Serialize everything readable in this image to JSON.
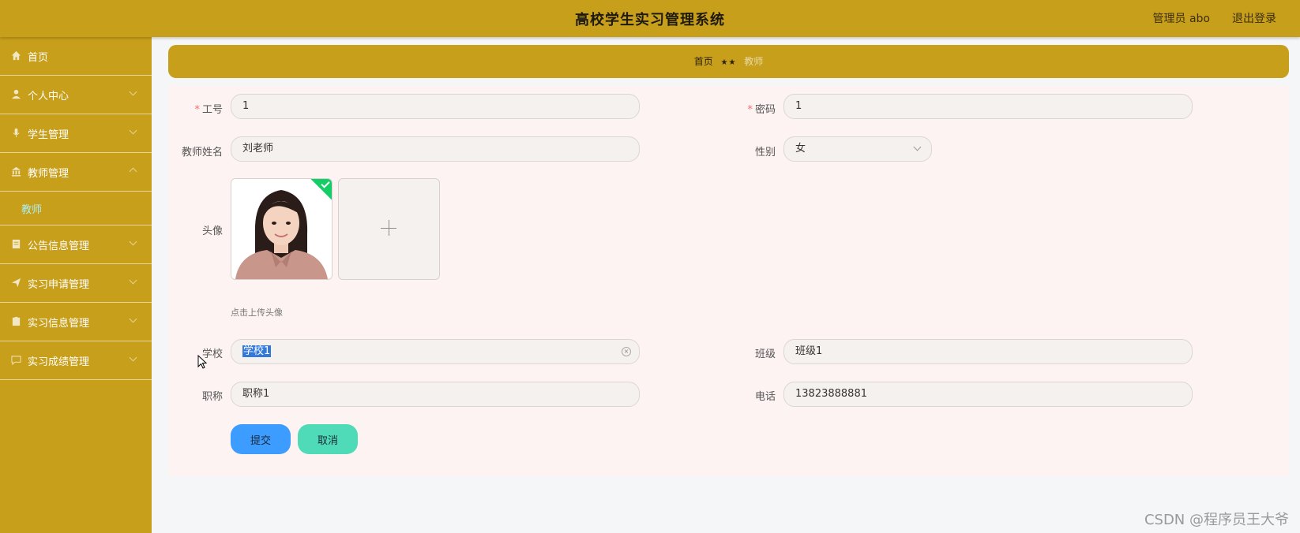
{
  "header": {
    "title": "高校学生实习管理系统",
    "user": "管理员 abo",
    "logout": "退出登录"
  },
  "sidebar": {
    "items": [
      {
        "label": "首页",
        "icon": "home-icon"
      },
      {
        "label": "个人中心",
        "icon": "user-icon"
      },
      {
        "label": "学生管理",
        "icon": "mic-icon"
      },
      {
        "label": "教师管理",
        "icon": "bank-icon"
      },
      {
        "label": "公告信息管理",
        "icon": "doc-icon"
      },
      {
        "label": "实习申请管理",
        "icon": "send-icon"
      },
      {
        "label": "实习信息管理",
        "icon": "clipboard-icon"
      },
      {
        "label": "实习成绩管理",
        "icon": "chat-icon"
      }
    ],
    "subitem": "教师"
  },
  "breadcrumb": {
    "home": "首页",
    "separator": "★★",
    "current": "教师"
  },
  "form": {
    "gonghao_label": "工号",
    "gonghao_value": "1",
    "mima_label": "密码",
    "mima_value": "1",
    "name_label": "教师姓名",
    "name_value": "刘老师",
    "gender_label": "性别",
    "gender_value": "女",
    "avatar_label": "头像",
    "upload_tip": "点击上传头像",
    "school_label": "学校",
    "school_value": "学校1",
    "class_label": "班级",
    "class_value": "班级1",
    "title_label": "职称",
    "title_value": "职称1",
    "phone_label": "电话",
    "phone_value": "13823888881",
    "submit": "提交",
    "cancel": "取消"
  },
  "watermark": "CSDN @程序员王大爷",
  "colors": {
    "primary": "#c89f1a",
    "submit": "#3c9cff",
    "cancel": "#4fdbb7",
    "active_sub": "#a9eef5"
  }
}
